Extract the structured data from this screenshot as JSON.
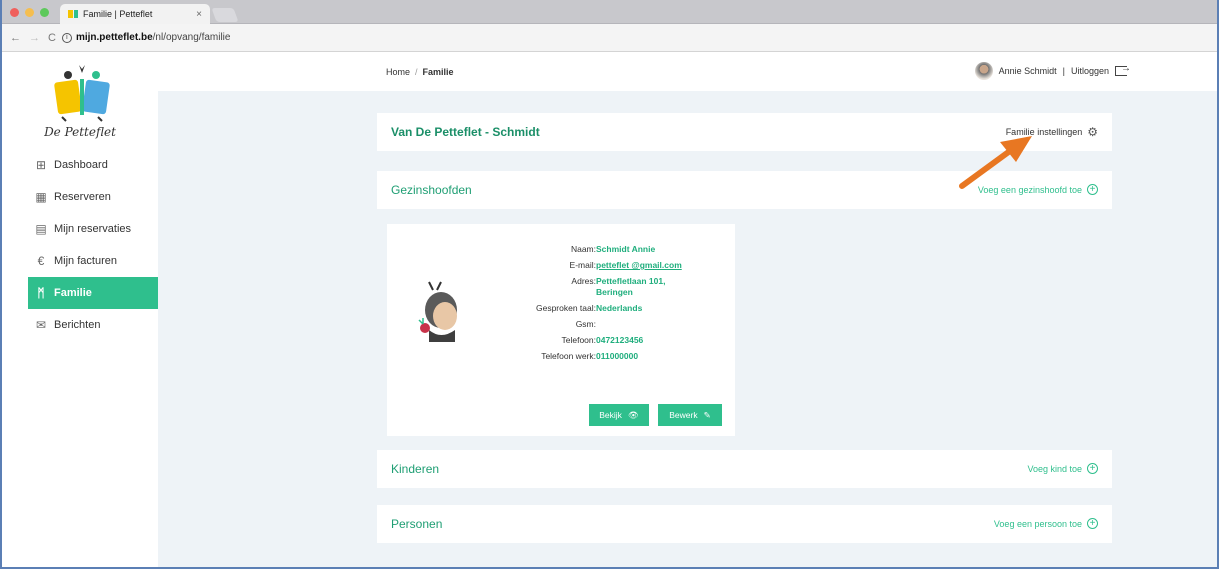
{
  "browser": {
    "tab_title": "Familie | Petteflet",
    "tab_close": "×",
    "url_domain": "mijn.petteflet.be",
    "url_path": "/nl/opvang/familie",
    "back": "←",
    "forward": "→",
    "reload": "C"
  },
  "sidebar": {
    "logo_text": "De Petteflet",
    "items": [
      {
        "label": "Dashboard",
        "icon": "dashboard-icon",
        "glyph": "⊞"
      },
      {
        "label": "Reserveren",
        "icon": "calendar-icon",
        "glyph": "▦"
      },
      {
        "label": "Mijn reservaties",
        "icon": "document-icon",
        "glyph": "▤"
      },
      {
        "label": "Mijn facturen",
        "icon": "euro-icon",
        "glyph": "€"
      },
      {
        "label": "Familie",
        "icon": "family-icon",
        "glyph": "ᛗ"
      },
      {
        "label": "Berichten",
        "icon": "message-icon",
        "glyph": "✉"
      }
    ],
    "active_index": 4
  },
  "topbar": {
    "breadcrumb_home": "Home",
    "breadcrumb_sep": "/",
    "breadcrumb_current": "Familie",
    "user_name": "Annie Schmidt",
    "divider": "|",
    "logout": "Uitloggen"
  },
  "family": {
    "title": "Van De Petteflet - Schmidt",
    "settings_label": "Familie instellingen",
    "settings_icon": "⚙"
  },
  "sections": {
    "heads_title": "Gezinshoofden",
    "heads_action": "Voeg een gezinshoofd toe",
    "children_title": "Kinderen",
    "children_action": "Voeg kind toe",
    "persons_title": "Personen",
    "persons_action": "Voeg een persoon toe",
    "plus": "+"
  },
  "person": {
    "fields": [
      {
        "label": "Naam:",
        "value": "Schmidt Annie",
        "link": false
      },
      {
        "label": "E-mail:",
        "value": "petteflet @gmail.com",
        "link": true
      },
      {
        "label": "Adres:",
        "value": "Pettefletlaan 101, Beringen",
        "link": false
      },
      {
        "label": "Gesproken taal:",
        "value": "Nederlands",
        "link": false
      },
      {
        "label": "Gsm:",
        "value": "",
        "link": false
      },
      {
        "label": "Telefoon:",
        "value": "0472123456",
        "link": false
      },
      {
        "label": "Telefoon werk:",
        "value": "011000000",
        "link": false
      }
    ],
    "view_label": "Bekijk",
    "view_icon": "👁",
    "edit_label": "Bewerk",
    "edit_icon": "✎"
  },
  "colors": {
    "accent": "#2fbf8d",
    "arrow": "#e87722",
    "background": "#eef3f7"
  }
}
